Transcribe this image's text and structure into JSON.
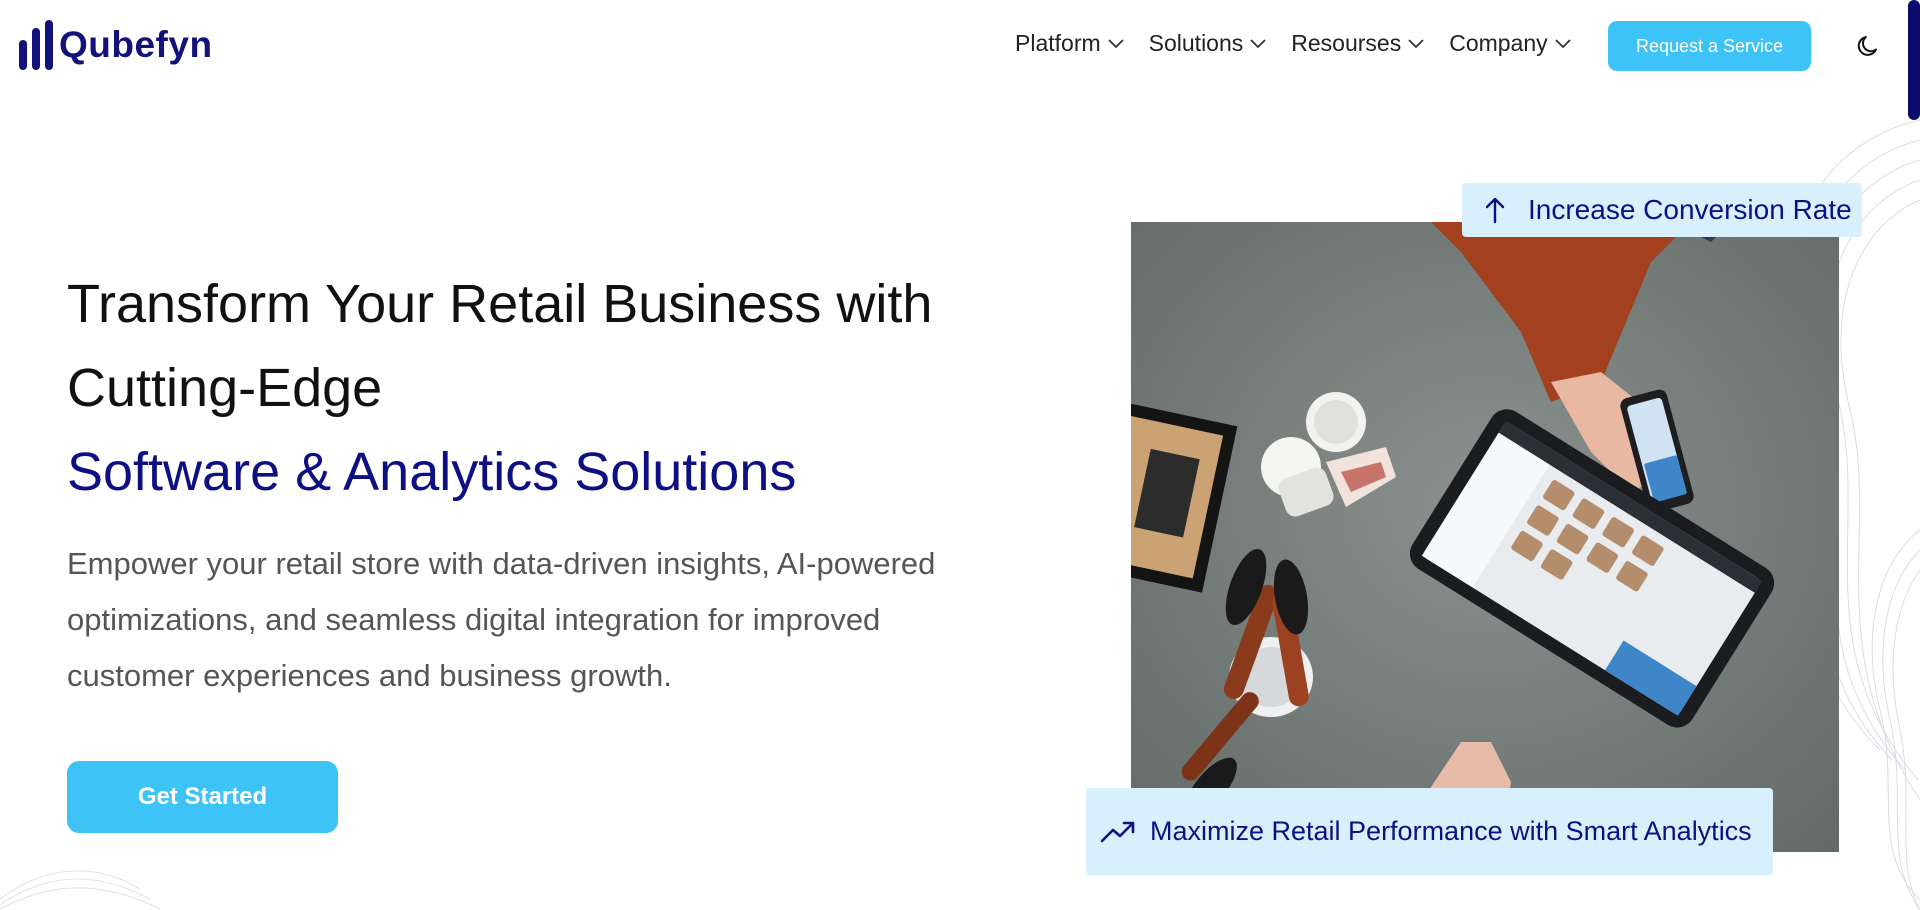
{
  "brand": {
    "name": "Qubefyn",
    "color": "#12127a"
  },
  "nav": {
    "items": [
      {
        "label": "Platform"
      },
      {
        "label": "Solutions"
      },
      {
        "label": "Resourses"
      },
      {
        "label": "Company"
      }
    ],
    "cta_label": "Request a Service",
    "theme_icon": "moon-icon"
  },
  "hero": {
    "title_line1": "Transform Your Retail Business with",
    "title_line2": "Cutting-Edge",
    "title_highlight": "Software & Analytics Solutions",
    "description": "Empower your retail store with data-driven insights, AI-powered optimizations, and seamless digital integration for improved customer experiences and business growth.",
    "cta_label": "Get Started"
  },
  "badges": {
    "top": {
      "icon": "arrow-up-icon",
      "label": "Increase Conversion Rate"
    },
    "bottom": {
      "icon": "trending-up-icon",
      "label": "Maximize Retail Performance with Smart Analytics"
    }
  },
  "colors": {
    "accent": "#3ec3f7",
    "heading_blue": "#0f0f85",
    "badge_bg": "#d8f0fc"
  }
}
